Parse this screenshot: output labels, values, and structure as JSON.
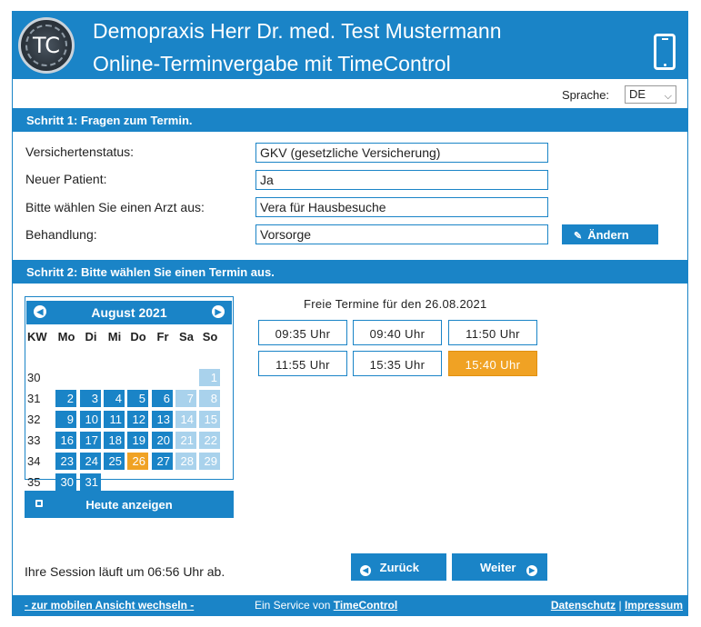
{
  "header": {
    "logo_text": "TC",
    "title": "Demopraxis Herr Dr. med. Test Mustermann",
    "subtitle": "Online-Terminvergabe mit TimeControl"
  },
  "language": {
    "label": "Sprache:",
    "value": "DE"
  },
  "step1": {
    "title": "Schritt 1: Fragen zum Termin.",
    "rows": [
      {
        "label": "Versichertenstatus:",
        "value": "GKV (gesetzliche Versicherung)"
      },
      {
        "label": "Neuer Patient:",
        "value": "Ja"
      },
      {
        "label": "Bitte wählen Sie einen Arzt aus:",
        "value": "Vera für Hausbesuche"
      },
      {
        "label": "Behandlung:",
        "value": "Vorsorge"
      }
    ],
    "change_label": "Ändern"
  },
  "step2": {
    "title": "Schritt 2: Bitte wählen Sie einen Termin aus."
  },
  "calendar": {
    "month": "August 2021",
    "weekday_headers": [
      "KW",
      "Mo",
      "Di",
      "Mi",
      "Do",
      "Fr",
      "Sa",
      "So"
    ],
    "weeks": [
      {
        "kw": "30",
        "days": [
          "",
          "",
          "",
          "",
          "",
          "",
          "1"
        ]
      },
      {
        "kw": "31",
        "days": [
          "2",
          "3",
          "4",
          "5",
          "6",
          "7",
          "8"
        ]
      },
      {
        "kw": "32",
        "days": [
          "9",
          "10",
          "11",
          "12",
          "13",
          "14",
          "15"
        ]
      },
      {
        "kw": "33",
        "days": [
          "16",
          "17",
          "18",
          "19",
          "20",
          "21",
          "22"
        ]
      },
      {
        "kw": "34",
        "days": [
          "23",
          "24",
          "25",
          "26",
          "27",
          "28",
          "29"
        ]
      },
      {
        "kw": "35",
        "days": [
          "30",
          "31",
          "",
          "",
          "",
          "",
          ""
        ]
      }
    ],
    "selected_day": "26",
    "today_label": "Heute anzeigen"
  },
  "slots": {
    "title": "Freie Termine für den 26.08.2021",
    "times": [
      "09:35 Uhr",
      "09:40 Uhr",
      "11:50 Uhr",
      "11:55 Uhr",
      "15:35 Uhr",
      "15:40 Uhr"
    ],
    "selected": "15:40 Uhr"
  },
  "session_text": "Ihre Session läuft um 06:56 Uhr ab.",
  "nav": {
    "back": "Zurück",
    "next": "Weiter"
  },
  "footer": {
    "mobile_link": "- zur mobilen Ansicht wechseln -",
    "service_prefix": "Ein Service von ",
    "service_link": "TimeControl",
    "privacy": "Datenschutz",
    "separator": "|",
    "imprint": "Impressum"
  },
  "colors": {
    "primary": "#1a84c7",
    "weekend": "#a9d2ec",
    "selected": "#f0a224"
  }
}
